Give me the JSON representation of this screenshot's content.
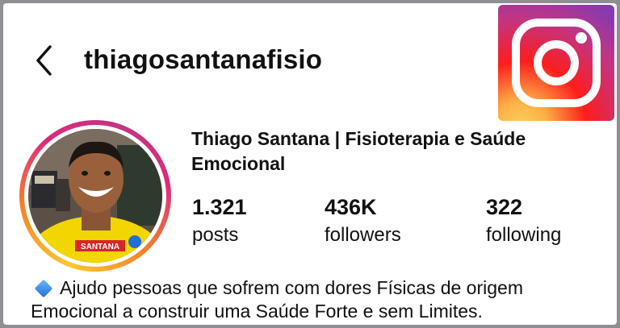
{
  "header": {
    "username": "thiagosantanafisio",
    "back_icon": "chevron-left-icon",
    "logo_icon": "instagram-logo-icon"
  },
  "profile": {
    "display_name": "Thiago Santana | Fisioterapia e Saúde Emocional",
    "avatar_shirt_text": "SANTANA"
  },
  "stats": {
    "posts": {
      "value": "1.321",
      "label": "posts"
    },
    "followers": {
      "value": "436K",
      "label": "followers"
    },
    "following": {
      "value": "322",
      "label": "following"
    }
  },
  "bio": {
    "line1": "Ajudo pessoas que sofrem com dores Físicas de origem",
    "line2": "Emocional a construir uma Saúde Forte e sem Limites.",
    "bullet_icon": "blue-diamond-icon"
  },
  "colors": {
    "text": "#111111",
    "ring_gradient": [
      "#fdc830",
      "#f58529",
      "#dd2a7b",
      "#c13584"
    ],
    "bullet": "#1f6fd6"
  }
}
